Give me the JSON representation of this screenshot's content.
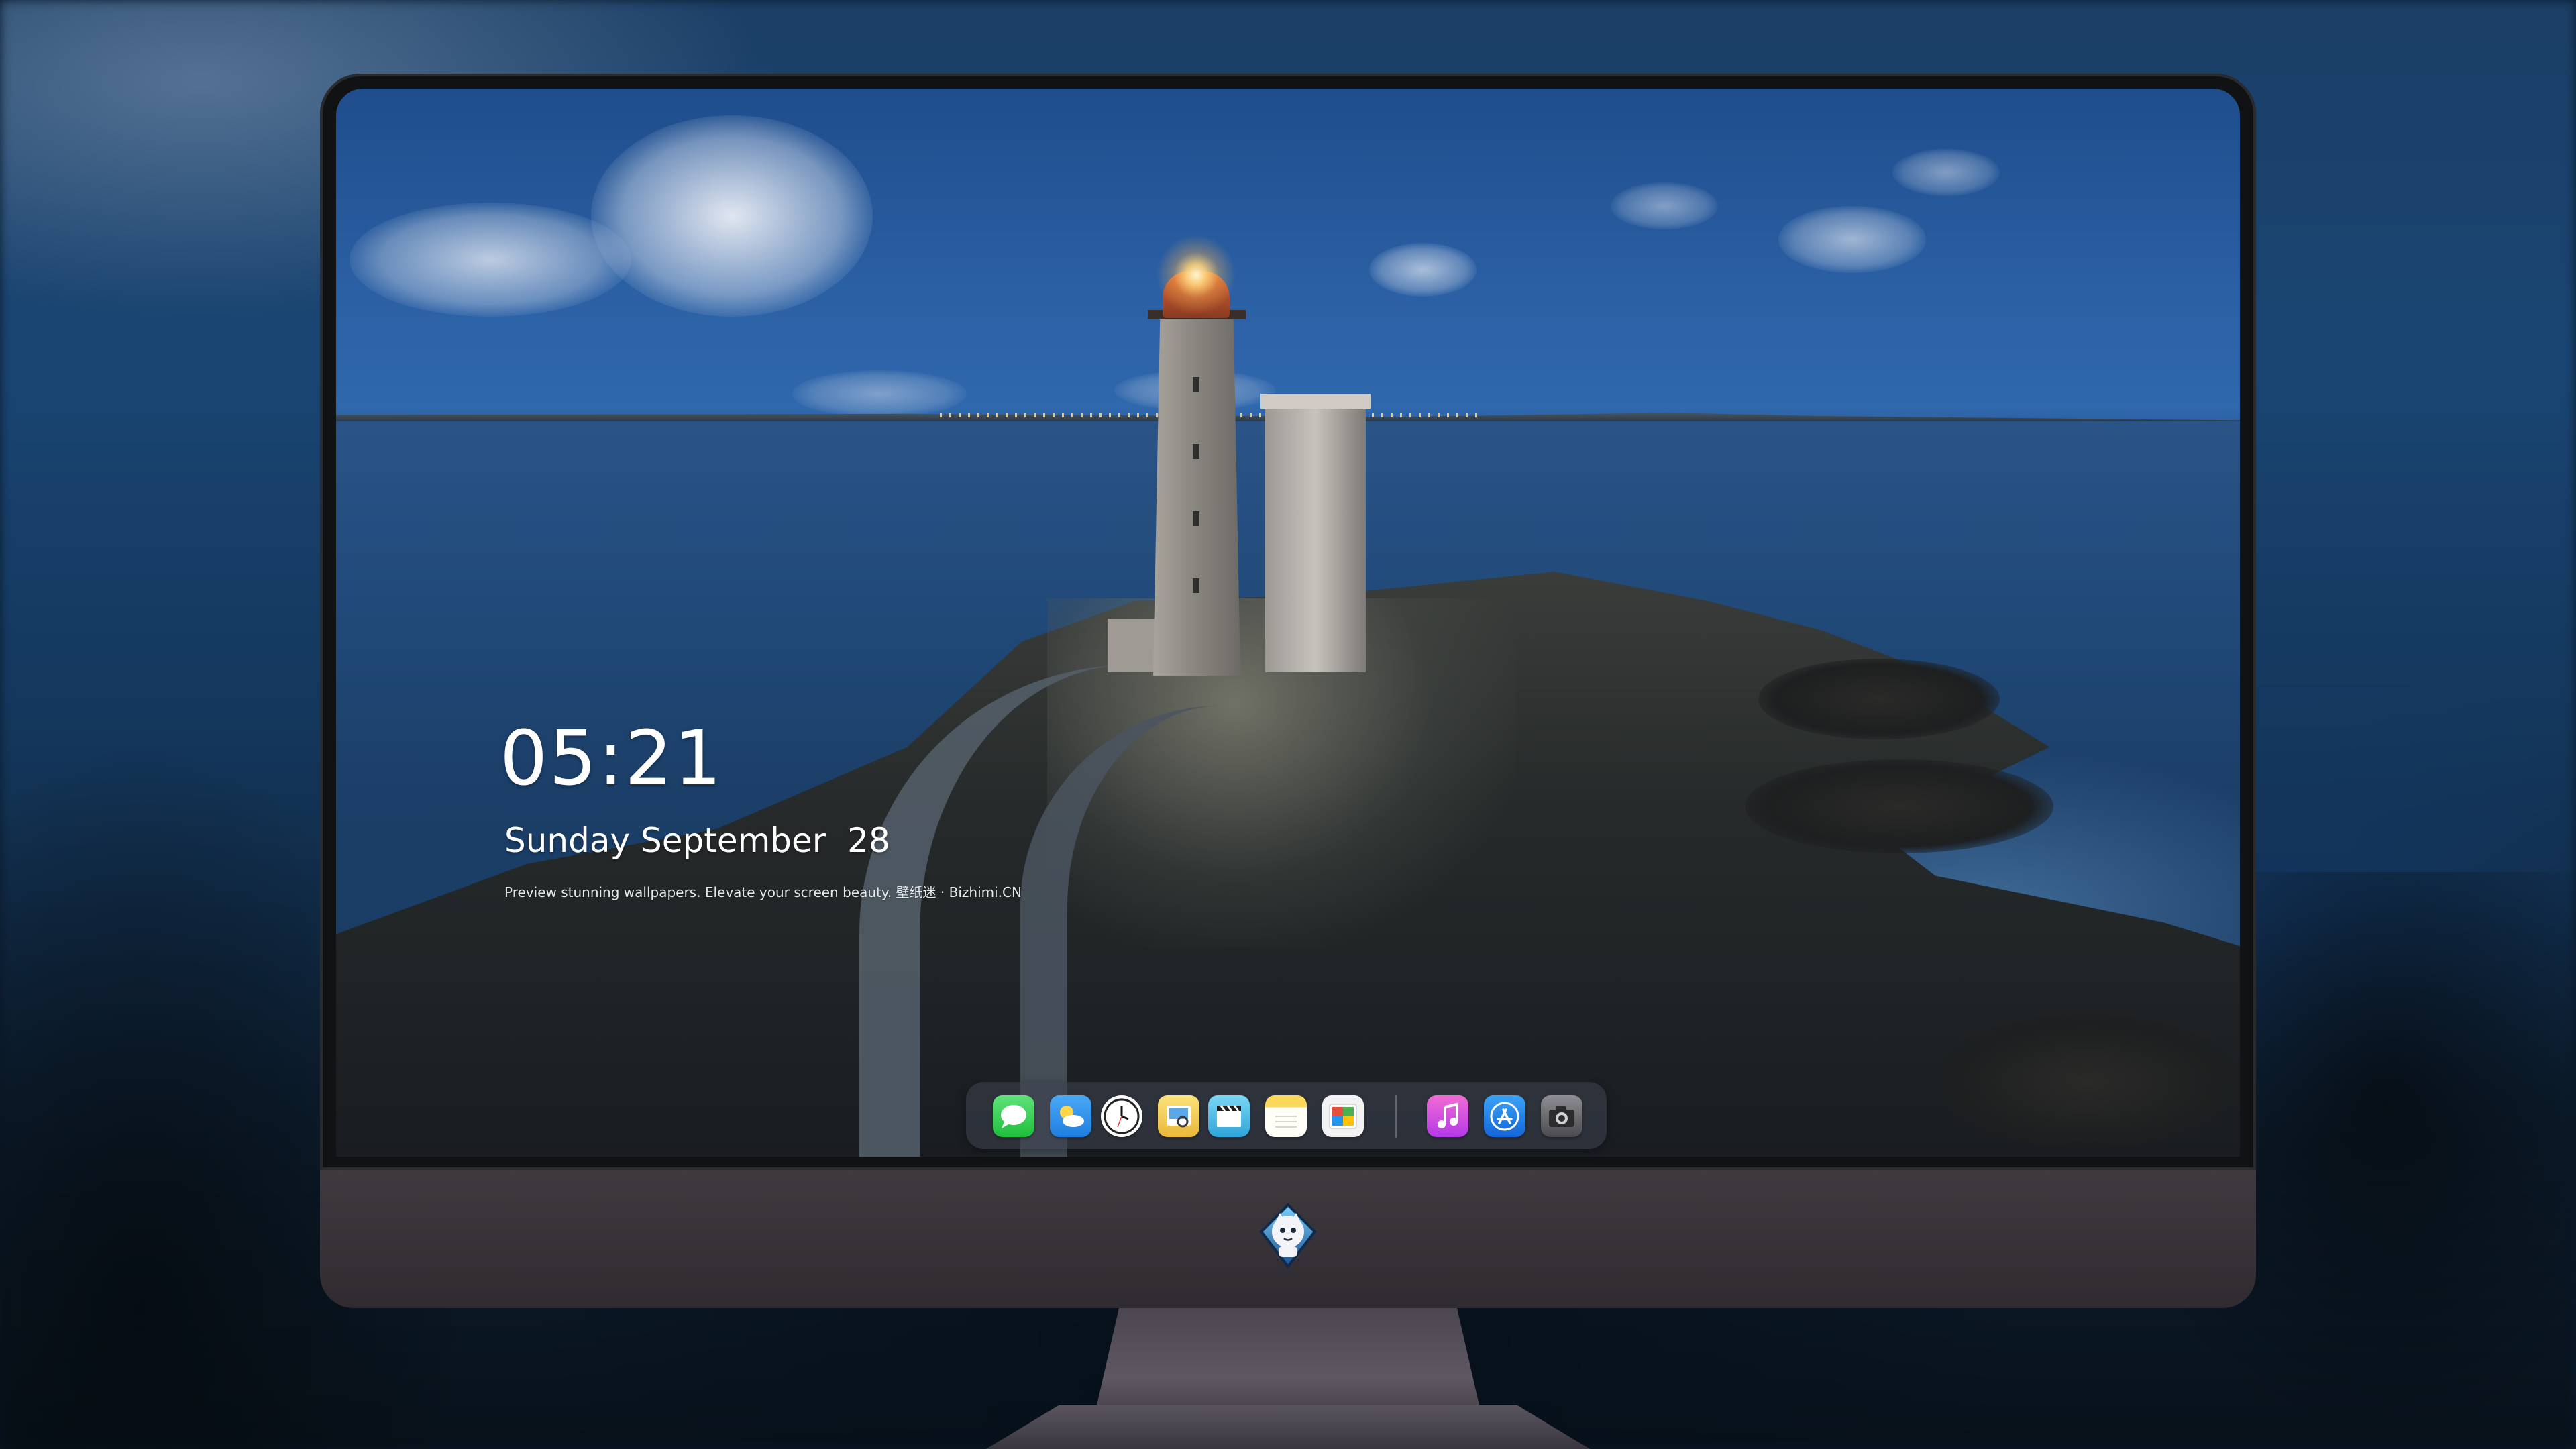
{
  "lock_screen": {
    "time": "05:21",
    "date": "Sunday September  28",
    "tagline": "Preview stunning wallpapers. Elevate your screen beauty. 壁纸迷 · Bizhimi.CN"
  },
  "dock": {
    "apps": [
      {
        "name": "messages-icon",
        "color": "#2bd04b"
      },
      {
        "name": "weather-icon",
        "color": "#3a9cf0"
      },
      {
        "name": "clock-icon",
        "color": "#ffffff"
      },
      {
        "name": "preview-icon",
        "color": "#f2c94c"
      },
      {
        "name": "video-editor-icon",
        "color": "#46b8e6"
      },
      {
        "name": "notes-icon",
        "color": "#f7d24a"
      },
      {
        "name": "photos-icon",
        "color": "#e8e8e8"
      },
      {
        "name": "music-icon",
        "color": "#d94ee8"
      },
      {
        "name": "app-store-icon",
        "color": "#1f8ef1"
      },
      {
        "name": "camera-icon",
        "color": "#6e6e73"
      }
    ]
  },
  "colors": {
    "bezel": "#111214",
    "chin": "#3e3a3f",
    "dock_background": "#3c4250"
  }
}
